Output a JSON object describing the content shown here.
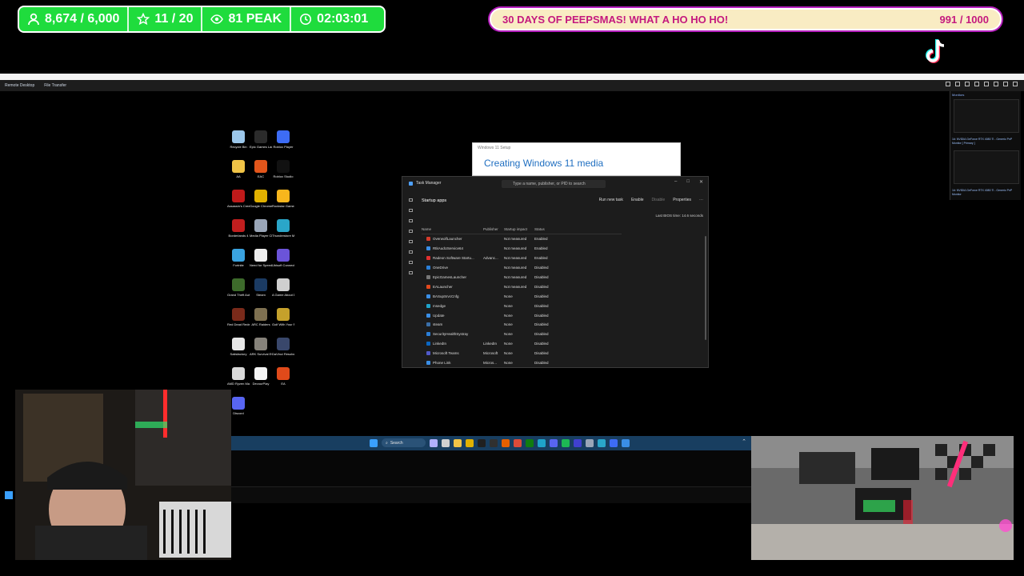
{
  "stream": {
    "stats": {
      "followers": "8,674 / 6,000",
      "rating": "11 / 20",
      "viewers": "81 PEAK",
      "uptime": "02:03:01"
    },
    "goal": {
      "label": "30 DAYS OF PEEPSMAS! WHAT A HO HO HO!",
      "progress": "991 / 1000",
      "progress_value": 0.991
    }
  },
  "remote_desktop": {
    "title": "",
    "toolbar": [
      "Remote Desktop",
      "File Transfer"
    ]
  },
  "desktop_icons": [
    {
      "label": "Recycle Bin",
      "icon": "recycle-bin-icon",
      "color": "#9cc7ea"
    },
    {
      "label": "Epic Games Launcher",
      "icon": "epic-games-icon",
      "color": "#2b2b2b"
    },
    {
      "label": "Roblox Player",
      "icon": "roblox-icon",
      "color": "#3d6cf5"
    },
    {
      "label": "AA",
      "icon": "folder-icon",
      "color": "#f1c447"
    },
    {
      "label": "EAC",
      "icon": "eac-icon",
      "color": "#e3561b"
    },
    {
      "label": "Roblox Studio",
      "icon": "roblox-studio-icon",
      "color": "#111111"
    },
    {
      "label": "Assassin's Creed S...",
      "icon": "assassins-creed-icon",
      "color": "#c01a1a"
    },
    {
      "label": "Google Chrome",
      "icon": "chrome-icon",
      "color": "#e1b100"
    },
    {
      "label": "Rockstar Games ...",
      "icon": "rockstar-icon",
      "color": "#f8b61c"
    },
    {
      "label": "Borderlands 4",
      "icon": "borderlands-icon",
      "color": "#c21e1e"
    },
    {
      "label": "Media Player Classic",
      "icon": "media-player-icon",
      "color": "#9aa6b8"
    },
    {
      "label": "Thunderstore Mod Mana...",
      "icon": "thunderstore-icon",
      "color": "#2aa6c9"
    },
    {
      "label": "Fortnite",
      "icon": "fortnite-icon",
      "color": "#3aa3e0"
    },
    {
      "label": "Need for Speed",
      "icon": "nfs-icon",
      "color": "#ededed"
    },
    {
      "label": "Ubisoft Connect",
      "icon": "ubisoft-icon",
      "color": "#6b54d9"
    },
    {
      "label": "Grand Theft Auto V En...",
      "icon": "gta-icon",
      "color": "#3d6b2b"
    },
    {
      "label": "Steam",
      "icon": "steam-icon",
      "color": "#1b3b63"
    },
    {
      "label": "A Game About D...",
      "icon": "game-icon",
      "color": "#cfcfcf"
    },
    {
      "label": "Red Dead Redempti...",
      "icon": "rdr-icon",
      "color": "#7a2a1a"
    },
    {
      "label": "ARC Raiders",
      "icon": "arc-raiders-icon",
      "color": "#7f7151"
    },
    {
      "label": "Golf With Your Friends",
      "icon": "golf-icon",
      "color": "#c5a12b"
    },
    {
      "label": "Satisfactory",
      "icon": "satisfactory-icon",
      "color": "#e6e6e6"
    },
    {
      "label": "ARK Survival Evolved",
      "icon": "ark-icon",
      "color": "#86827a"
    },
    {
      "label": "DaVinci Resolve",
      "icon": "davinci-icon",
      "color": "#39476b"
    },
    {
      "label": "AMD Ryzen Master",
      "icon": "amd-icon",
      "color": "#d9d9d9"
    },
    {
      "label": "DevourPlay",
      "icon": "document-icon",
      "color": "#f4f4f4"
    },
    {
      "label": "EA",
      "icon": "ea-icon",
      "color": "#e04a1a"
    },
    {
      "label": "Discord",
      "icon": "discord-icon",
      "color": "#5865f2"
    }
  ],
  "setup_window": {
    "title": "Windows 11 Setup",
    "heading": "Creating Windows 11 media"
  },
  "task_manager": {
    "title": "Task Manager",
    "search_placeholder": "Type a name, publisher, or PID to search",
    "page_title": "Startup apps",
    "actions": [
      "Run new task",
      "Enable",
      "Disable",
      "Properties"
    ],
    "bios_time": "Last BIOS time: 14.6 seconds",
    "columns": [
      "Name",
      "Publisher",
      "Startup impact",
      "Status"
    ],
    "rows": [
      {
        "name": "OverwolfLauncher",
        "publisher": "",
        "impact": "Not measured",
        "status": "Enabled",
        "color": "#d43b2b"
      },
      {
        "name": "RtkAudUService64",
        "publisher": "",
        "impact": "Not measured",
        "status": "Enabled",
        "color": "#3a8ee6"
      },
      {
        "name": "Radeon Software Startu...",
        "publisher": "Advanc...",
        "impact": "Not measured",
        "status": "Enabled",
        "color": "#e03030"
      },
      {
        "name": "OneDrive",
        "publisher": "",
        "impact": "Not measured",
        "status": "Disabled",
        "color": "#2a7fd8"
      },
      {
        "name": "EpicGamesLauncher",
        "publisher": "",
        "impact": "Not measured",
        "status": "Disabled",
        "color": "#777777"
      },
      {
        "name": "EALauncher",
        "publisher": "",
        "impact": "Not measured",
        "status": "Disabled",
        "color": "#e2481d"
      },
      {
        "name": "BASupSrvcCnfg",
        "publisher": "",
        "impact": "None",
        "status": "Disabled",
        "color": "#3a8ee6"
      },
      {
        "name": "msedge",
        "publisher": "",
        "impact": "None",
        "status": "Disabled",
        "color": "#1fa3c9"
      },
      {
        "name": "Update",
        "publisher": "",
        "impact": "None",
        "status": "Disabled",
        "color": "#3a8ee6"
      },
      {
        "name": "steam",
        "publisher": "",
        "impact": "None",
        "status": "Disabled",
        "color": "#3a6fa8"
      },
      {
        "name": "SecurityHealthSystray",
        "publisher": "",
        "impact": "None",
        "status": "Disabled",
        "color": "#2a7fd8"
      },
      {
        "name": "LinkedIn",
        "publisher": "LinkedIn",
        "impact": "None",
        "status": "Disabled",
        "color": "#0a66c2"
      },
      {
        "name": "Microsoft Teams",
        "publisher": "Microsoft",
        "impact": "None",
        "status": "Disabled",
        "color": "#5059c9"
      },
      {
        "name": "Phone Link",
        "publisher": "Micros...",
        "impact": "None",
        "status": "Disabled",
        "color": "#3a8ee6"
      }
    ]
  },
  "taskbar": {
    "search_label": "Search",
    "icons": [
      {
        "name": "copilot-icon",
        "color": "#b0b0ff"
      },
      {
        "name": "task-view-icon",
        "color": "#d0d0d0"
      },
      {
        "name": "file-explorer-icon",
        "color": "#f1c447"
      },
      {
        "name": "chrome-taskbar-icon",
        "color": "#e1b100"
      },
      {
        "name": "terminal-icon",
        "color": "#202020"
      },
      {
        "name": "obs-icon",
        "color": "#303030"
      },
      {
        "name": "firefox-icon",
        "color": "#e66000"
      },
      {
        "name": "chrome-alt-icon",
        "color": "#dd4b39"
      },
      {
        "name": "xbox-icon",
        "color": "#107c10"
      },
      {
        "name": "edge-icon",
        "color": "#1fa3c9"
      },
      {
        "name": "discord-taskbar-icon",
        "color": "#5865f2"
      },
      {
        "name": "spotify-icon",
        "color": "#1db954"
      },
      {
        "name": "streamdeck-icon",
        "color": "#4040d0"
      },
      {
        "name": "settings-taskbar-icon",
        "color": "#9aa6b8"
      },
      {
        "name": "app-icon",
        "color": "#2aa6c9"
      },
      {
        "name": "store-icon",
        "color": "#3d6cf5"
      },
      {
        "name": "task-manager-taskbar-icon",
        "color": "#3a8ee6"
      }
    ]
  },
  "monitors": {
    "title": "Monitors",
    "monitor1": "1#: NVIDIA GeForce RTX 4080 Ti - Generic PnP Monitor [ Primary ]",
    "monitor2": "1#: NVIDIA GeForce RTX 4080 Ti - Generic PnP Monitor"
  },
  "colors": {
    "stats_bg": "#1fdc3d",
    "goal_text": "#c4197e",
    "goal_bg": "#f9ecc3",
    "taskbar_bg": "#183e60"
  }
}
